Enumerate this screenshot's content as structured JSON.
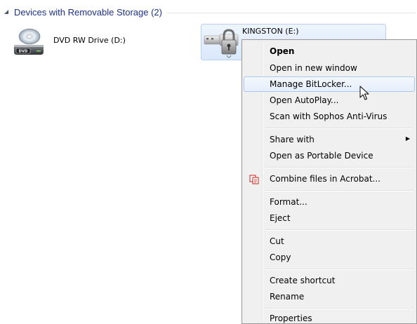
{
  "group": {
    "title": "Devices with Removable Storage (2)"
  },
  "drives": {
    "dvd": {
      "label": "DVD RW Drive (D:)",
      "icon": "dvd-drive-icon",
      "icon_text": "DVD"
    },
    "kingston": {
      "label": "KINGSTON (E:)",
      "icon": "locked-usb-drive-icon"
    }
  },
  "menu": {
    "items": [
      {
        "label": "Open"
      },
      {
        "label": "Open in new window"
      },
      {
        "label": "Manage BitLocker..."
      },
      {
        "label": "Open AutoPlay..."
      },
      {
        "label": "Scan with Sophos Anti-Virus"
      },
      {
        "label": "Share with"
      },
      {
        "label": "Open as Portable Device"
      },
      {
        "label": "Combine files in Acrobat..."
      },
      {
        "label": "Format..."
      },
      {
        "label": "Eject"
      },
      {
        "label": "Cut"
      },
      {
        "label": "Copy"
      },
      {
        "label": "Create shortcut"
      },
      {
        "label": "Rename"
      },
      {
        "label": "Properties"
      }
    ],
    "hovered_item": "Manage BitLocker...",
    "submenu_item": "Share with",
    "default_item": "Open"
  },
  "colors": {
    "group_title": "#1e3287",
    "selection_border": "#b8d0f1",
    "menu_background": "#f0f0f0",
    "acrobat_red": "#cc1f1a"
  }
}
